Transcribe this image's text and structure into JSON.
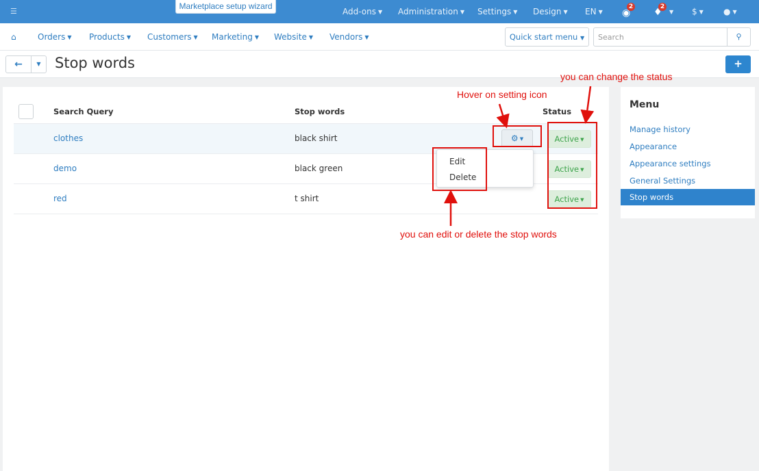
{
  "topbar": {
    "wizard_label": "Marketplace setup wizard",
    "menus": [
      "Add-ons",
      "Administration",
      "Settings",
      "Design",
      "EN"
    ],
    "badges": {
      "updates": "2",
      "notifications": "2"
    },
    "currency": "$"
  },
  "navbar": {
    "items": [
      "Orders",
      "Products",
      "Customers",
      "Marketing",
      "Website",
      "Vendors"
    ],
    "quick_start": "Quick start menu",
    "search_placeholder": "Search"
  },
  "page": {
    "title": "Stop words"
  },
  "table": {
    "headers": {
      "query": "Search Query",
      "words": "Stop words",
      "status": "Status"
    },
    "rows": [
      {
        "query": "clothes",
        "words": "black shirt",
        "status": "Active"
      },
      {
        "query": "demo",
        "words": "black green",
        "status": "Active"
      },
      {
        "query": "red",
        "words": "t shirt",
        "status": "Active"
      }
    ]
  },
  "dropdown": {
    "edit": "Edit",
    "delete": "Delete"
  },
  "sidebar": {
    "title": "Menu",
    "items": [
      "Manage history",
      "Appearance",
      "Appearance settings",
      "General Settings",
      "Stop words"
    ],
    "active_index": 4
  },
  "annotations": {
    "status_hint": "you can change the status",
    "hover_hint": "Hover on setting icon",
    "edit_hint": "you can edit or delete the stop words"
  },
  "colors": {
    "topbar": "#3d8bd1",
    "link": "#2e7dc0",
    "active_status": "#3ca34a",
    "annotation": "#e0100c"
  }
}
